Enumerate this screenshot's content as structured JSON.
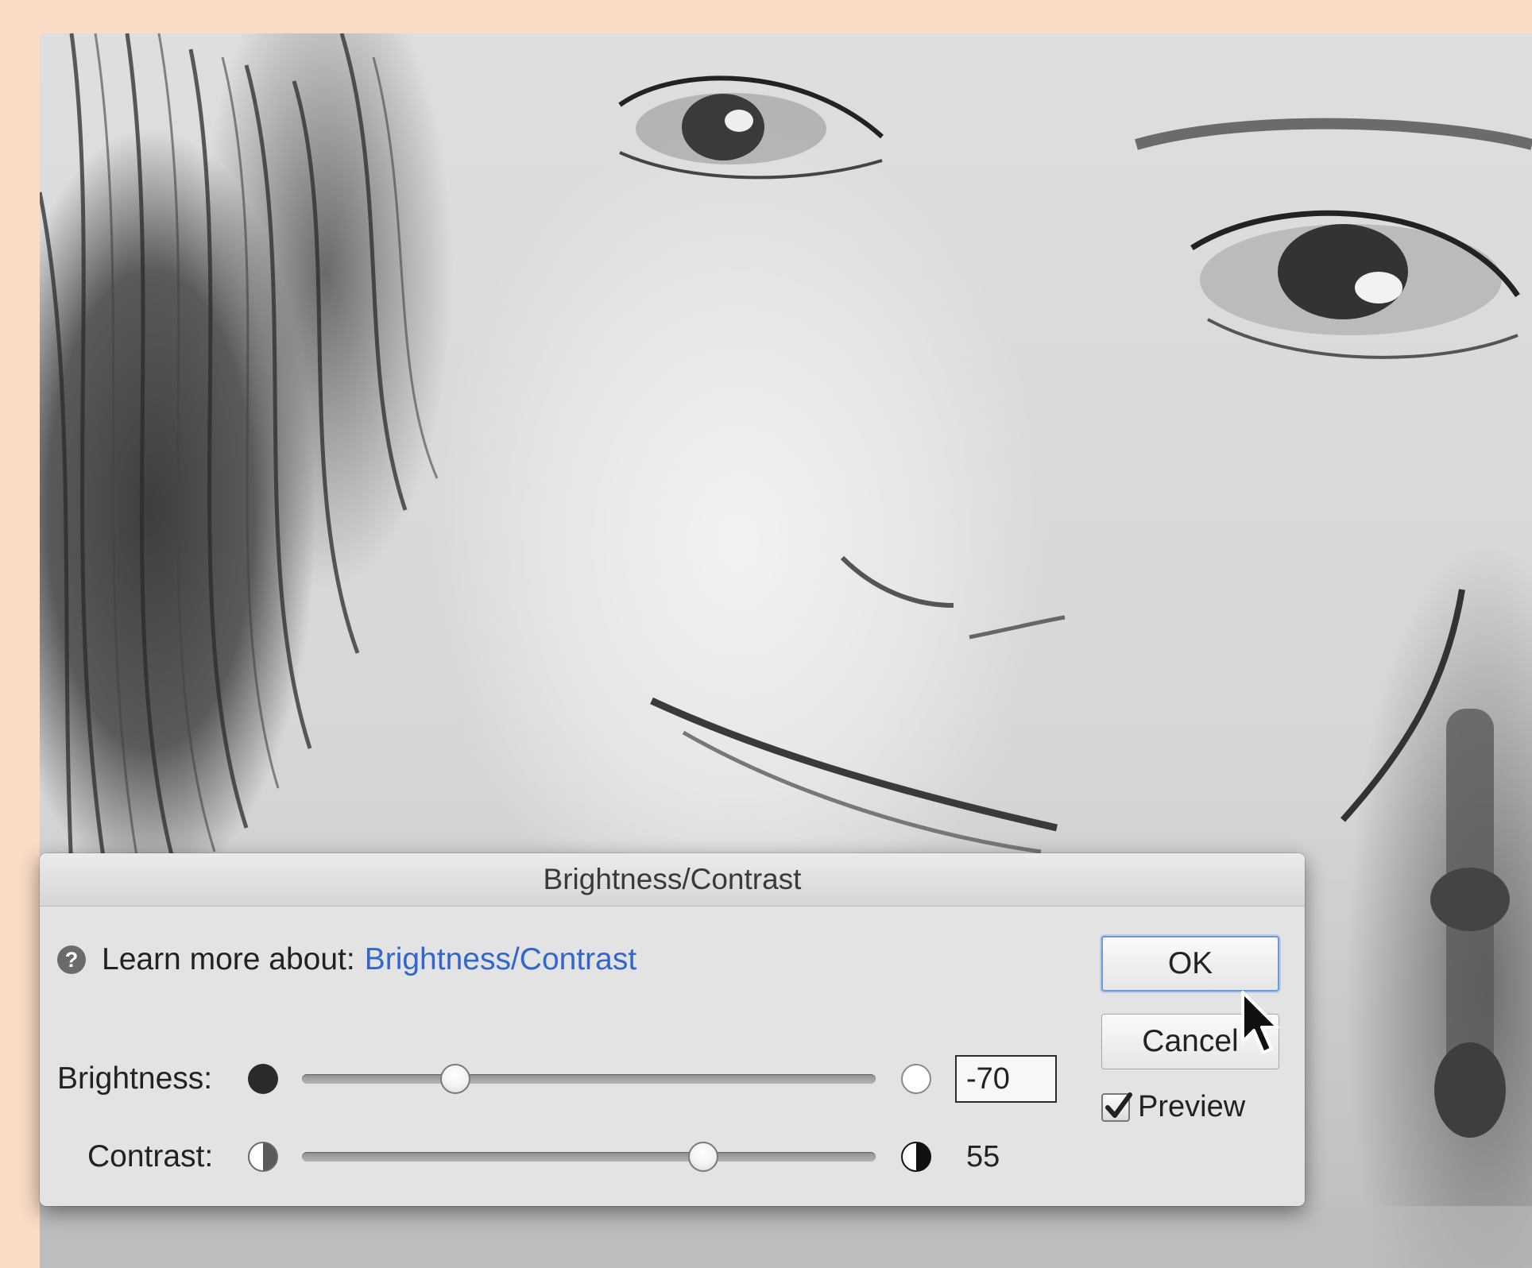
{
  "dialog": {
    "title": "Brightness/Contrast",
    "help_text": "Learn more about:",
    "help_link": "Brightness/Contrast",
    "help_icon": "?",
    "brightness": {
      "label": "Brightness:",
      "value": "-70",
      "min": -150,
      "max": 150,
      "level": -70
    },
    "contrast": {
      "label": "Contrast:",
      "value": "55",
      "min": -50,
      "max": 100,
      "level": 55
    },
    "ok_label": "OK",
    "cancel_label": "Cancel",
    "preview_label": "Preview",
    "preview_checked": true
  },
  "colors": {
    "background": "#f9dcc6",
    "dialog": "#e3e3e3",
    "link": "#3366cc",
    "ok_focus": "#6a9ad8"
  },
  "icons": {
    "brightness_low": "filled-dark-circle-icon",
    "brightness_high": "empty-light-circle-icon",
    "contrast_low": "half-circle-icon",
    "contrast_high": "half-circle-icon"
  }
}
